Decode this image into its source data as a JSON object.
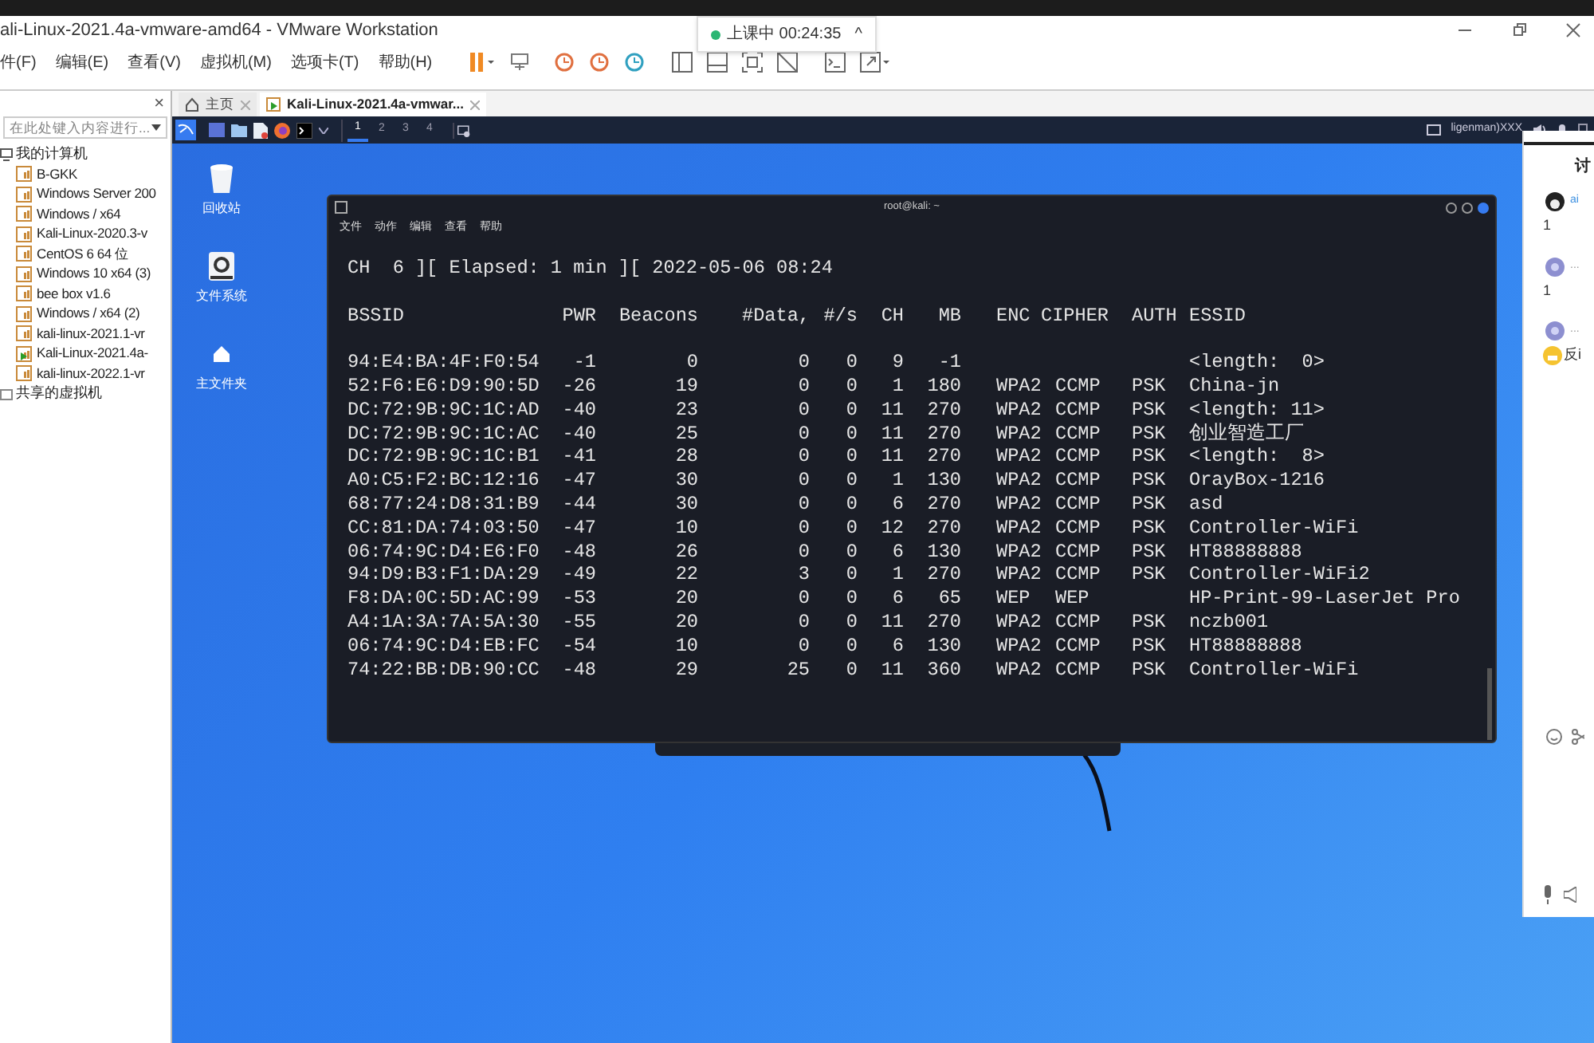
{
  "window": {
    "title": "ali-Linux-2021.4a-vmware-amd64 - VMware Workstation"
  },
  "class_status": {
    "label": "上课中 00:24:35",
    "caret": "^"
  },
  "menu": [
    "件(F)",
    "编辑(E)",
    "查看(V)",
    "虚拟机(M)",
    "选项卡(T)",
    "帮助(H)"
  ],
  "library": {
    "close": "×",
    "search": {
      "placeholder": "在此处键入内容进行..."
    },
    "tree": [
      {
        "label": "我的计算机",
        "expanded": true,
        "children": [
          {
            "label": "B-GKK",
            "running": false
          },
          {
            "label": "Windows Server 200",
            "running": false
          },
          {
            "label": "Windows / x64",
            "running": false
          },
          {
            "label": "Kali-Linux-2020.3-v",
            "running": false
          },
          {
            "label": "CentOS 6 64 位",
            "running": false
          },
          {
            "label": "Windows 10 x64 (3)",
            "running": false
          },
          {
            "label": "bee box v1.6",
            "running": false
          },
          {
            "label": "Windows / x64 (2)",
            "running": false
          },
          {
            "label": "kali-linux-2021.1-vr",
            "running": false
          },
          {
            "label": "Kali-Linux-2021.4a-",
            "running": true
          },
          {
            "label": "kali-linux-2022.1-vr",
            "running": false
          }
        ]
      },
      {
        "label": "共享的虚拟机",
        "expanded": false
      }
    ]
  },
  "tabs": [
    {
      "label": "主页",
      "selected": false,
      "kind": "home"
    },
    {
      "label": "Kali-Linux-2021.4a-vmwar...",
      "selected": true,
      "kind": "vm"
    }
  ],
  "guest_panel": {
    "workspaces": [
      {
        "label": "1",
        "selected": true
      },
      {
        "label": "2",
        "selected": false
      },
      {
        "label": "3",
        "selected": false
      },
      {
        "label": "4",
        "selected": false
      }
    ],
    "user": "ligenman)XXX"
  },
  "desktop_icons": [
    {
      "label": "回收站",
      "kind": "trash"
    },
    {
      "label": "文件系统",
      "kind": "drive"
    },
    {
      "label": "主文件夹",
      "kind": "home"
    }
  ],
  "terminal": {
    "title": "root@kali: ~",
    "menu": [
      "文件",
      "动作",
      "编辑",
      "查看",
      "帮助"
    ],
    "status_line": "CH  6 ][ Elapsed: 1 min ][ 2022-05-06 08:24",
    "columns": [
      "BSSID",
      "PWR",
      "Beacons",
      "#Data,",
      "#/s",
      "CH",
      "MB",
      "ENC",
      "CIPHER",
      "AUTH",
      "ESSID"
    ],
    "rows": [
      {
        "bssid": "94:E4:BA:4F:F0:54",
        "pwr": "-1",
        "beacons": "0",
        "data": "0",
        "per_s": "0",
        "ch": "9",
        "mb": "-1",
        "essid": "<length:  0>"
      },
      {
        "bssid": "52:F6:E6:D9:90:5D",
        "pwr": "-26",
        "beacons": "19",
        "data": "0",
        "per_s": "0",
        "ch": "1",
        "mb": "180",
        "enc": "WPA2",
        "cipher": "CCMP",
        "auth": "PSK",
        "essid": "China-jn"
      },
      {
        "bssid": "DC:72:9B:9C:1C:AD",
        "pwr": "-40",
        "beacons": "23",
        "data": "0",
        "per_s": "0",
        "ch": "11",
        "mb": "270",
        "enc": "WPA2",
        "cipher": "CCMP",
        "auth": "PSK",
        "essid": "<length: 11>"
      },
      {
        "bssid": "DC:72:9B:9C:1C:AC",
        "pwr": "-40",
        "beacons": "25",
        "data": "0",
        "per_s": "0",
        "ch": "11",
        "mb": "270",
        "enc": "WPA2",
        "cipher": "CCMP",
        "auth": "PSK",
        "essid": "创业智造工厂"
      },
      {
        "bssid": "DC:72:9B:9C:1C:B1",
        "pwr": "-41",
        "beacons": "28",
        "data": "0",
        "per_s": "0",
        "ch": "11",
        "mb": "270",
        "enc": "WPA2",
        "cipher": "CCMP",
        "auth": "PSK",
        "essid": "<length:  8>"
      },
      {
        "bssid": "A0:C5:F2:BC:12:16",
        "pwr": "-47",
        "beacons": "30",
        "data": "0",
        "per_s": "0",
        "ch": "1",
        "mb": "130",
        "enc": "WPA2",
        "cipher": "CCMP",
        "auth": "PSK",
        "essid": "OrayBox-1216"
      },
      {
        "bssid": "68:77:24:D8:31:B9",
        "pwr": "-44",
        "beacons": "30",
        "data": "0",
        "per_s": "0",
        "ch": "6",
        "mb": "270",
        "enc": "WPA2",
        "cipher": "CCMP",
        "auth": "PSK",
        "essid": "asd"
      },
      {
        "bssid": "CC:81:DA:74:03:50",
        "pwr": "-47",
        "beacons": "10",
        "data": "0",
        "per_s": "0",
        "ch": "12",
        "mb": "270",
        "enc": "WPA2",
        "cipher": "CCMP",
        "auth": "PSK",
        "essid": "Controller-WiFi"
      },
      {
        "bssid": "06:74:9C:D4:E6:F0",
        "pwr": "-48",
        "beacons": "26",
        "data": "0",
        "per_s": "0",
        "ch": "6",
        "mb": "130",
        "enc": "WPA2",
        "cipher": "CCMP",
        "auth": "PSK",
        "essid": "HT88888888"
      },
      {
        "bssid": "94:D9:B3:F1:DA:29",
        "pwr": "-49",
        "beacons": "22",
        "data": "3",
        "per_s": "0",
        "ch": "1",
        "mb": "270",
        "enc": "WPA2",
        "cipher": "CCMP",
        "auth": "PSK",
        "essid": "Controller-WiFi2"
      },
      {
        "bssid": "F8:DA:0C:5D:AC:99",
        "pwr": "-53",
        "beacons": "20",
        "data": "0",
        "per_s": "0",
        "ch": "6",
        "mb": "65",
        "enc": "WEP",
        "cipher": "WEP",
        "essid": "HP-Print-99-LaserJet Pro"
      },
      {
        "bssid": "A4:1A:3A:7A:5A:30",
        "pwr": "-55",
        "beacons": "20",
        "data": "0",
        "per_s": "0",
        "ch": "11",
        "mb": "270",
        "enc": "WPA2",
        "cipher": "CCMP",
        "auth": "PSK",
        "essid": "nczb001"
      },
      {
        "bssid": "06:74:9C:D4:EB:FC",
        "pwr": "-54",
        "beacons": "10",
        "data": "0",
        "per_s": "0",
        "ch": "6",
        "mb": "130",
        "enc": "WPA2",
        "cipher": "CCMP",
        "auth": "PSK",
        "essid": "HT88888888"
      },
      {
        "bssid": "74:22:BB:DB:90:CC",
        "pwr": "-48",
        "beacons": "29",
        "data": "25",
        "per_s": "0",
        "ch": "11",
        "mb": "360",
        "enc": "WPA2",
        "cipher": "CCMP",
        "auth": "PSK",
        "essid": "Controller-WiFi"
      }
    ]
  },
  "chat": {
    "title": "讨",
    "messages": [
      {
        "name": "ai",
        "text": "1"
      },
      {
        "name": "...",
        "text": "1"
      },
      {
        "name": "...",
        "text": "反i",
        "emoji": true
      }
    ]
  }
}
